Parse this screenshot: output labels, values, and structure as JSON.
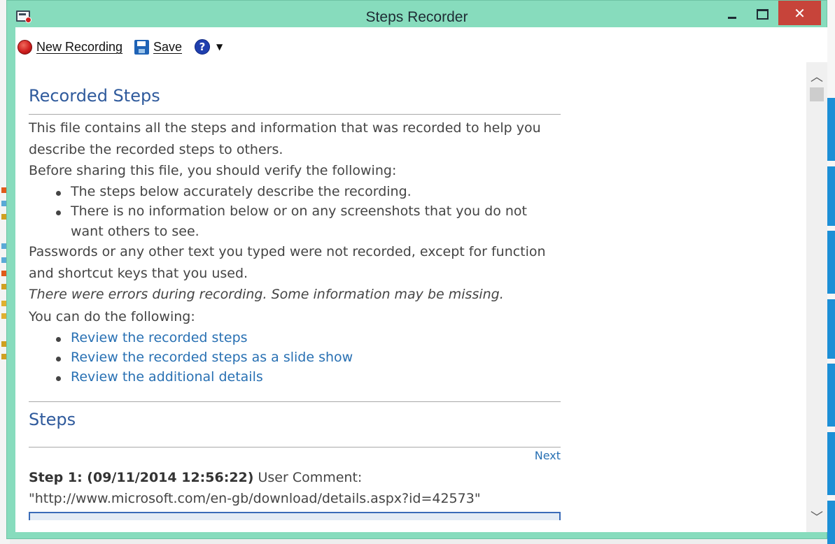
{
  "window": {
    "title": "Steps Recorder",
    "close_glyph": "✕"
  },
  "toolbar": {
    "new_recording_label": "New Recording",
    "save_label": "Save",
    "help_glyph": "?",
    "dropdown_glyph": "▼"
  },
  "document": {
    "recorded_steps": {
      "heading": "Recorded Steps",
      "intro_1": "This file contains all the steps and information that was recorded to help you",
      "intro_2": "describe the recorded steps to others.",
      "verify_intro": "Before sharing this file, you should verify the following:",
      "verify_items": [
        [
          "The steps below accurately describe the recording."
        ],
        [
          "There is no information below or on any screenshots that you do not",
          "want others to see."
        ]
      ],
      "passwords_1": "Passwords or any other text you typed were not recorded, except for function",
      "passwords_2": "and shortcut keys that you used.",
      "errors_note": "There were errors during recording. Some information may be missing.",
      "can_do": "You can do the following:",
      "links": [
        "Review the recorded steps",
        "Review the recorded steps as a slide show",
        "Review the additional details"
      ]
    },
    "steps": {
      "heading": "Steps",
      "next_label": "Next",
      "step1_label": "Step 1: (09/11/2014 12:56:22)",
      "step1_comment_label": " User Comment:",
      "step1_comment": "\"http://www.microsoft.com/en-gb/download/details.aspx?id=42573\""
    }
  },
  "scrollbar": {
    "up_glyph": "︿",
    "down_glyph": "﹀"
  },
  "colors": {
    "title_bar": "#87dcbd",
    "close_button": "#c7443a",
    "heading": "#2f5a9c",
    "link": "#2870b3",
    "body_text": "#444444"
  },
  "icons": [
    "record-icon",
    "save-icon",
    "help-icon",
    "app-icon"
  ]
}
